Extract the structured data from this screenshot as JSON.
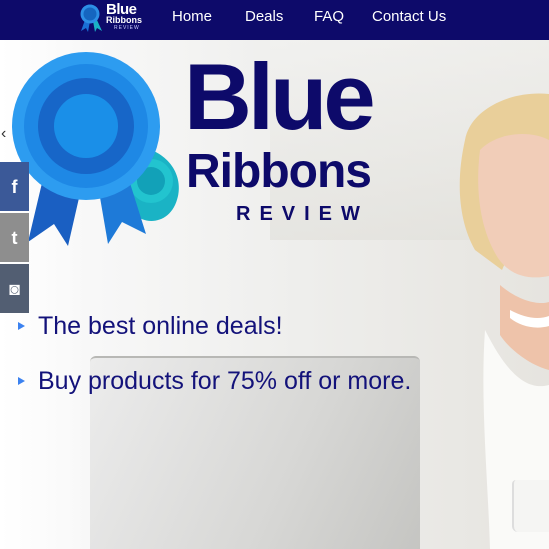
{
  "nav": {
    "logo": {
      "line1": "Blue",
      "line2": "Ribbons",
      "line3": "REVIEW"
    },
    "items": [
      {
        "label": "Home"
      },
      {
        "label": "Deals"
      },
      {
        "label": "FAQ"
      },
      {
        "label": "Contact Us"
      }
    ]
  },
  "hero": {
    "logo": {
      "line1": "Blue",
      "line2": "Ribbons",
      "line3": "REVIEW"
    },
    "bullets": [
      {
        "text": "The best online deals!"
      },
      {
        "text": "Buy products for 75% off or more."
      }
    ],
    "prev_arrow": "‹"
  },
  "social": {
    "facebook": {
      "icon": "facebook-icon",
      "glyph": "f"
    },
    "twitter": {
      "icon": "twitter-icon",
      "glyph": "t"
    },
    "instagram": {
      "icon": "instagram-icon",
      "glyph": "◙"
    }
  },
  "colors": {
    "navy": "#0d0a6a",
    "ribbon_blue": "#1e88e5",
    "ribbon_teal": "#1ab3c5",
    "bullet_blue": "#3c82f0",
    "facebook": "#3b5998",
    "twitter": "#8e8e8e",
    "instagram": "#525e72"
  }
}
